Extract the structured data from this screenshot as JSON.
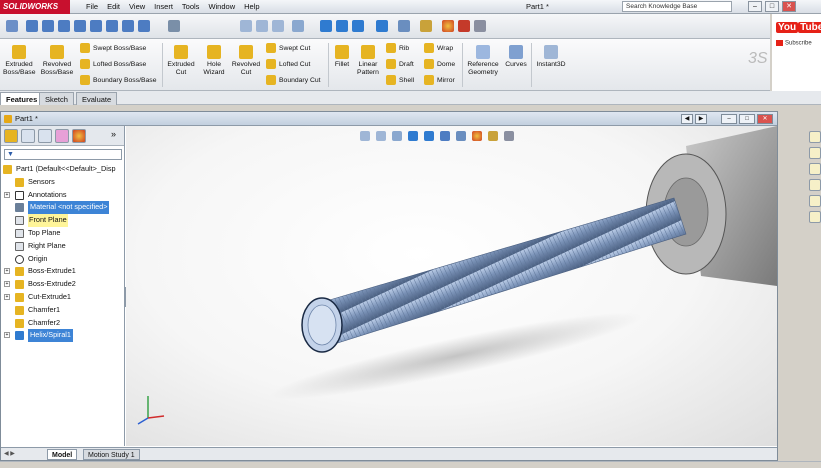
{
  "app": {
    "logo": "SOLIDWORKS",
    "title": "Part1 *"
  },
  "menu": [
    "File",
    "Edit",
    "View",
    "Insert",
    "Tools",
    "Window",
    "Help"
  ],
  "search": {
    "placeholder": "Search Knowledge Base"
  },
  "youtube": {
    "logo_a": "You",
    "logo_b": "Tube",
    "subscribe": "Subscribe"
  },
  "commands": {
    "extruded_boss": "Extruded Boss/Base",
    "revolved_boss": "Revolved Boss/Base",
    "swept_boss": "Swept Boss/Base",
    "lofted_boss": "Lofted Boss/Base",
    "boundary_boss": "Boundary Boss/Base",
    "extruded_cut": "Extruded Cut",
    "hole_wizard": "Hole Wizard",
    "revolved_cut": "Revolved Cut",
    "swept_cut": "Swept Cut",
    "lofted_cut": "Lofted Cut",
    "boundary_cut": "Boundary Cut",
    "fillet": "Fillet",
    "linear_pattern": "Linear Pattern",
    "rib": "Rib",
    "draft": "Draft",
    "shell": "Shell",
    "wrap": "Wrap",
    "dome": "Dome",
    "mirror": "Mirror",
    "reference_geometry": "Reference Geometry",
    "curves": "Curves",
    "instant3d": "Instant3D"
  },
  "tabs": [
    "Features",
    "Sketch",
    "Evaluate"
  ],
  "document": {
    "title": "Part1 *"
  },
  "tree": {
    "root": "Part1  (Default<<Default>_Disp",
    "items": [
      {
        "label": "Sensors",
        "icon": "sensor-icon",
        "expand": false
      },
      {
        "label": "Annotations",
        "icon": "annotation-icon",
        "expand": true
      },
      {
        "label": "Material <not specified>",
        "icon": "material-icon",
        "expand": false,
        "state": "selected"
      },
      {
        "label": "Front Plane",
        "icon": "plane-icon",
        "expand": false,
        "state": "highlight"
      },
      {
        "label": "Top Plane",
        "icon": "plane-icon",
        "expand": false
      },
      {
        "label": "Right Plane",
        "icon": "plane-icon",
        "expand": false
      },
      {
        "label": "Origin",
        "icon": "origin-icon",
        "expand": false
      },
      {
        "label": "Boss-Extrude1",
        "icon": "extrude-icon",
        "expand": true
      },
      {
        "label": "Boss-Extrude2",
        "icon": "extrude-icon",
        "expand": true
      },
      {
        "label": "Cut-Extrude1",
        "icon": "cut-icon",
        "expand": true
      },
      {
        "label": "Chamfer1",
        "icon": "chamfer-icon",
        "expand": false
      },
      {
        "label": "Chamfer2",
        "icon": "chamfer-icon",
        "expand": false
      },
      {
        "label": "Helix/Spiral1",
        "icon": "helix-icon",
        "expand": true,
        "state": "selected"
      }
    ]
  },
  "bottom_tabs": [
    "Model",
    "Motion Study 1"
  ],
  "colors": {
    "accent": "#3d84d6",
    "brand": "#c8102e",
    "highlight": "#fff59a",
    "part": "#7b93b8"
  }
}
